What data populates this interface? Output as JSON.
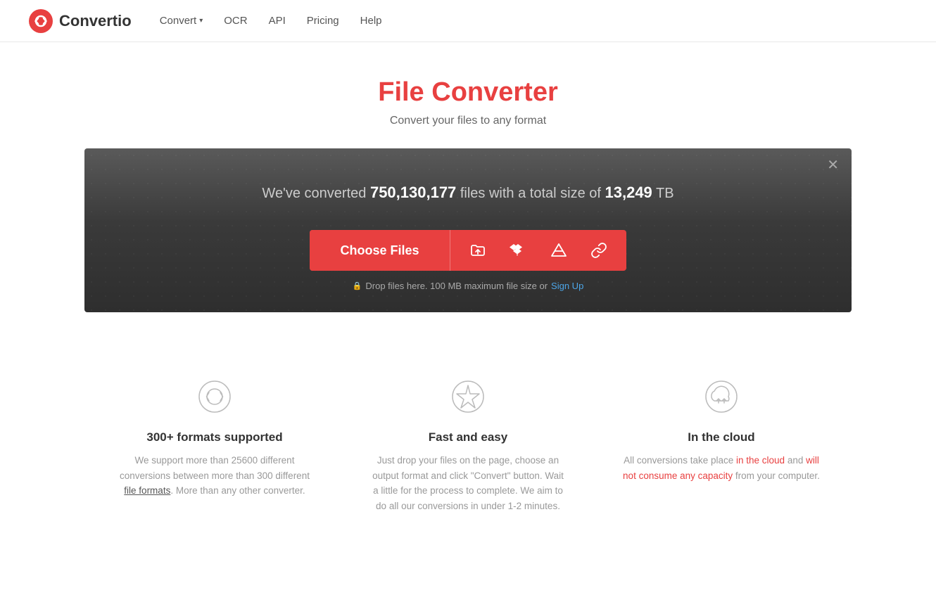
{
  "header": {
    "logo_text": "Convertio",
    "nav": [
      {
        "id": "convert",
        "label": "Convert",
        "has_dropdown": true
      },
      {
        "id": "ocr",
        "label": "OCR",
        "has_dropdown": false
      },
      {
        "id": "api",
        "label": "API",
        "has_dropdown": false
      },
      {
        "id": "pricing",
        "label": "Pricing",
        "has_dropdown": false
      },
      {
        "id": "help",
        "label": "Help",
        "has_dropdown": false
      }
    ]
  },
  "hero": {
    "title": "File Converter",
    "subtitle": "Convert your files to any format"
  },
  "converter": {
    "stats_prefix": "We've converted ",
    "stats_count": "750,130,177",
    "stats_middle": " files with a total size of ",
    "stats_size": "13,249",
    "stats_suffix": " TB",
    "choose_files_label": "Choose Files",
    "drop_text": "Drop files here. 100 MB maximum file size or ",
    "signup_link": "Sign Up"
  },
  "features": [
    {
      "id": "formats",
      "title": "300+ formats supported",
      "description": "We support more than 25600 different conversions between more than 300 different file formats. More than any other converter.",
      "link_text": "file formats"
    },
    {
      "id": "fast",
      "title": "Fast and easy",
      "description": "Just drop your files on the page, choose an output format and click \"Convert\" button. Wait a little for the process to complete. We aim to do all our conversions in under 1-2 minutes."
    },
    {
      "id": "cloud",
      "title": "In the cloud",
      "description": "All conversions take place in the cloud and will not consume any capacity from your computer."
    }
  ],
  "colors": {
    "accent": "#e84040",
    "link": "#4da6e8"
  }
}
